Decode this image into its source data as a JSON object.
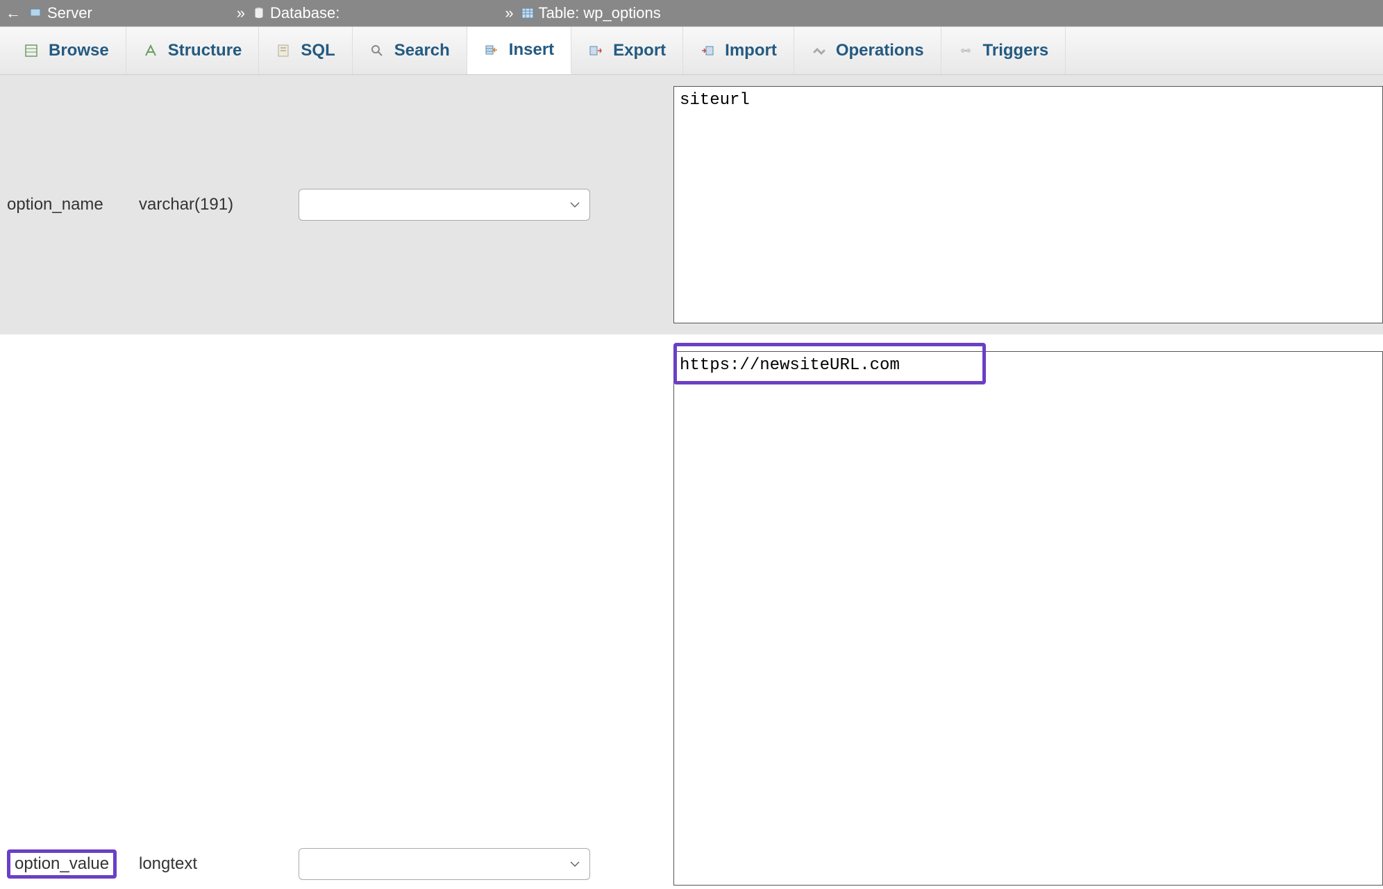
{
  "breadcrumb": {
    "server_label": "Server",
    "database_label": "Database:",
    "table_label": "Table: wp_options"
  },
  "tabs": {
    "browse": "Browse",
    "structure": "Structure",
    "sql": "SQL",
    "search": "Search",
    "insert": "Insert",
    "export": "Export",
    "import": "Import",
    "operations": "Operations",
    "triggers": "Triggers"
  },
  "fields": {
    "option_name": {
      "label": "option_name",
      "type": "varchar(191)",
      "value": "siteurl"
    },
    "option_value": {
      "label": "option_value",
      "type": "longtext",
      "value": "https://newsiteURL.com"
    }
  }
}
